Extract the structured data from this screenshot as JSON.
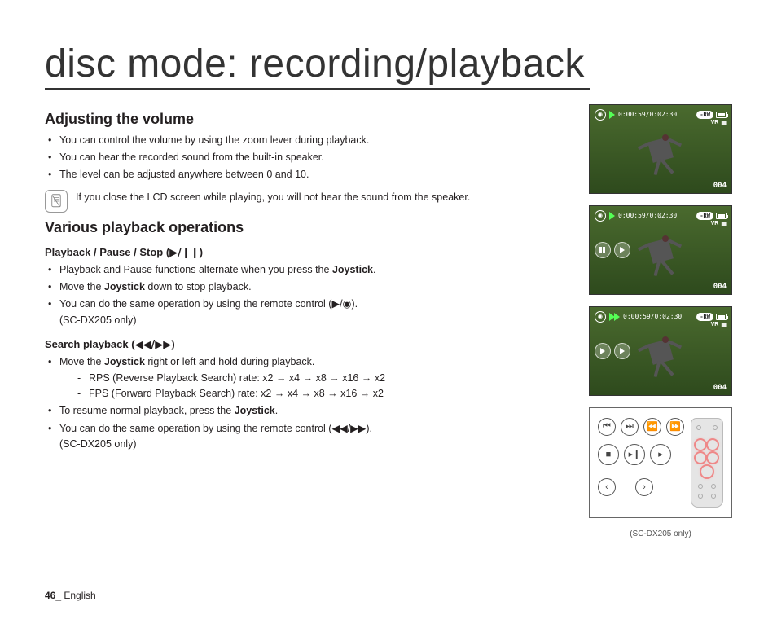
{
  "page_title": "disc mode: recording/playback",
  "footer": {
    "page_num": "46",
    "sep": "_ ",
    "lang": "English"
  },
  "section1": {
    "title": "Adjusting the volume",
    "bullets": [
      "You can control the volume by using the zoom lever during playback.",
      "You can hear the recorded sound from the built-in speaker.",
      "The level can be adjusted anywhere between 0 and 10."
    ],
    "note": "If you close the LCD screen while playing, you will not hear the sound from the speaker."
  },
  "section2": {
    "title": "Various playback operations",
    "sub1": {
      "title_pre": "Playback / Pause / Stop (",
      "title_sym": "▶/❙❙",
      "title_post": ")",
      "b1_pre": "Playback and Pause functions alternate when you press the ",
      "b1_bold": "Joystick",
      "b1_post": ".",
      "b2_pre": "Move the ",
      "b2_bold": "Joystick",
      "b2_post": " down to stop playback.",
      "b3": "You can do the same operation by using the remote control (▶/◉).",
      "b3_note": "(SC-DX205 only)"
    },
    "sub2": {
      "title_pre": "Search playback (",
      "title_sym": "◀◀/▶▶",
      "title_post": ")",
      "b1_pre": "Move the ",
      "b1_bold": "Joystick",
      "b1_post": " right or left and hold during playback.",
      "d1": "RPS (Reverse Playback Search) rate: x2 → x4 → x8 → x16 → x2",
      "d2": "FPS (Forward Playback Search) rate: x2 → x4 → x8 → x16 → x2",
      "b2_pre": "To resume normal playback, press the ",
      "b2_bold": "Joystick",
      "b2_post": ".",
      "b3": "You can do the same operation by using the remote control (◀◀/▶▶).",
      "b3_note": "(SC-DX205 only)"
    }
  },
  "hud": {
    "timecode": "0:00:59/0:02:30",
    "disc_label": "-RW",
    "mode_label": "VR",
    "clip_num": "004"
  },
  "remote_caption": "(SC-DX205 only)"
}
